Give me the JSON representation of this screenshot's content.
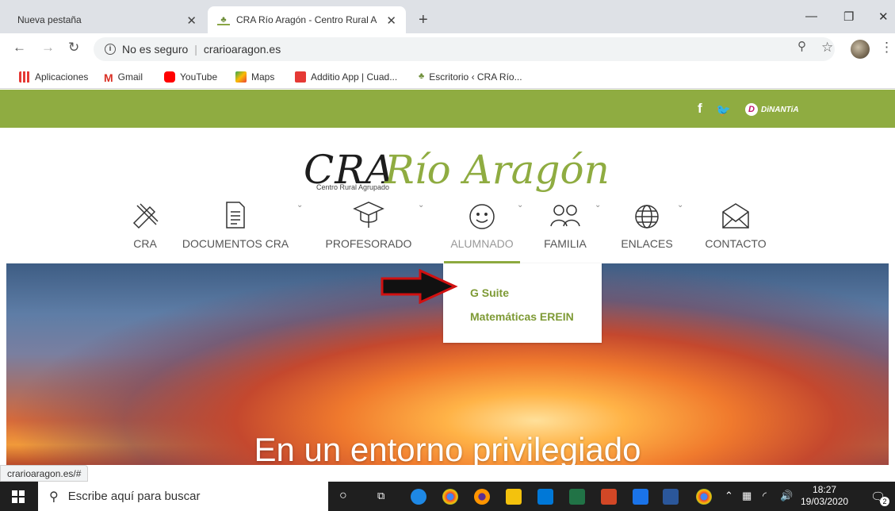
{
  "browser": {
    "tabs": [
      {
        "title": "Nueva pestaña"
      },
      {
        "title": "CRA Río Aragón - Centro Rural A"
      }
    ],
    "address": {
      "security": "No es seguro",
      "url": "crarioaragon.es"
    },
    "bookmarks": [
      {
        "label": "Aplicaciones",
        "color": "#d93025"
      },
      {
        "label": "Gmail",
        "color": "#d93025"
      },
      {
        "label": "YouTube",
        "color": "#ff0000"
      },
      {
        "label": "Maps",
        "color": "#34a853"
      },
      {
        "label": "Additio App | Cuad...",
        "color": "#e53935"
      },
      {
        "label": "Escritorio ‹ CRA Río...",
        "color": "#8aa645"
      }
    ],
    "status_url": "crarioaragon.es/#"
  },
  "site": {
    "social": {
      "facebook": "f",
      "dinantia": "DiNANTiA"
    },
    "logo": {
      "cra": "CRA",
      "rio": "Río Aragón",
      "subtitle": "Centro Rural Agrupado"
    },
    "menu": [
      {
        "label": "CRA",
        "icon": "pencil-ruler-icon"
      },
      {
        "label": "DOCUMENTOS CRA",
        "icon": "document-icon"
      },
      {
        "label": "PROFESORADO",
        "icon": "graduation-cap-icon"
      },
      {
        "label": "ALUMNADO",
        "icon": "smiley-icon"
      },
      {
        "label": "FAMILIA",
        "icon": "family-icon"
      },
      {
        "label": "ENLACES",
        "icon": "globe-icon"
      },
      {
        "label": "CONTACTO",
        "icon": "envelope-icon"
      }
    ],
    "dropdown": [
      "G Suite",
      "Matemáticas EREIN"
    ],
    "hero_title": "En un entorno privilegiado",
    "accent": "#8fac41"
  },
  "taskbar": {
    "search_placeholder": "Escribe aquí para buscar",
    "time": "18:27",
    "date": "19/03/2020",
    "notifications": "2"
  }
}
